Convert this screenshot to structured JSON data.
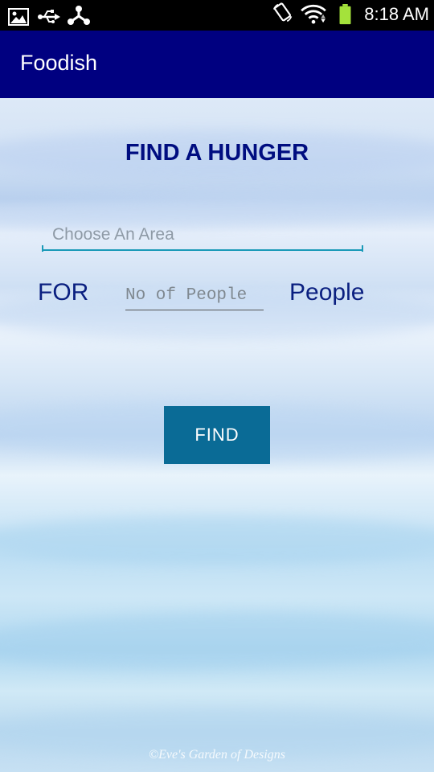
{
  "status_bar": {
    "time": "8:18 AM",
    "icons": [
      "image-icon",
      "usb-icon",
      "share-icon",
      "rotate-icon",
      "wifi-icon",
      "battery-icon"
    ],
    "battery_color": "#a4e23b"
  },
  "app_bar": {
    "title": "Foodish",
    "color": "#000080"
  },
  "main": {
    "heading": "FIND A HUNGER",
    "area_placeholder": "Choose An Area",
    "for_label": "FOR",
    "people_placeholder": "No of People",
    "people_label": "People",
    "find_button_label": "FIND",
    "button_color": "#0a6b96",
    "watermark": "©Eve's Garden of Designs"
  }
}
